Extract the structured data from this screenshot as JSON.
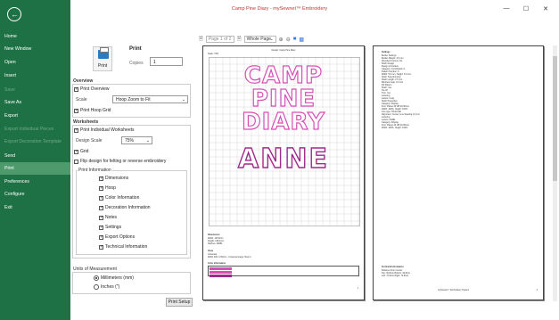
{
  "window": {
    "title": "Camp Pine Diary - mySewnet™ Embroidery",
    "minimize": "—",
    "maximize": "☐",
    "close": "✕"
  },
  "sidebar": {
    "back_icon": "arrow-left-icon",
    "items": [
      {
        "label": "Home",
        "state": "normal"
      },
      {
        "label": "New Window",
        "state": "normal"
      },
      {
        "label": "Open",
        "state": "normal"
      },
      {
        "label": "Insert",
        "state": "normal"
      },
      {
        "label": "Save",
        "state": "disabled"
      },
      {
        "label": "Save As",
        "state": "normal"
      },
      {
        "label": "Export",
        "state": "normal"
      },
      {
        "label": "Export Individual Pieces",
        "state": "disabled"
      },
      {
        "label": "Export Decoration Template",
        "state": "disabled"
      },
      {
        "label": "Send",
        "state": "normal"
      },
      {
        "label": "Print",
        "state": "active"
      },
      {
        "label": "Preferences",
        "state": "normal"
      },
      {
        "label": "Configure",
        "state": "normal"
      },
      {
        "label": "Exit",
        "state": "normal"
      }
    ]
  },
  "print": {
    "heading": "Print",
    "button_label": "Print",
    "copies_label": "Copies",
    "copies_value": "1"
  },
  "overview": {
    "title": "Overview",
    "print_overview": {
      "label": "Print Overview",
      "checked": true
    },
    "scale_label": "Scale",
    "scale_value": "Hoop Zoom to Fit",
    "print_hoop_grid": {
      "label": "Print Hoop Grid",
      "checked": true
    }
  },
  "worksheets": {
    "title": "Worksheets",
    "print_individual": {
      "label": "Print Individual Worksheets",
      "checked": true
    },
    "design_scale_label": "Design Scale",
    "design_scale_value": "75%",
    "grid": {
      "label": "Grid",
      "checked": true
    },
    "flip": {
      "label": "Flip design for felting or reverse embroidery",
      "checked": false
    },
    "print_info_title": "Print Information",
    "info_items": [
      {
        "label": "Dimensions",
        "checked": true
      },
      {
        "label": "Hoop",
        "checked": true
      },
      {
        "label": "Color Information",
        "checked": true
      },
      {
        "label": "Decoration Information",
        "checked": true
      },
      {
        "label": "Notes",
        "checked": true
      },
      {
        "label": "Settings",
        "checked": true
      },
      {
        "label": "Export Options",
        "checked": true
      },
      {
        "label": "Technical Information",
        "checked": true
      }
    ]
  },
  "units": {
    "title": "Units of Measurement",
    "options": [
      {
        "label": "Millimeters (mm)",
        "selected": true
      },
      {
        "label": "Inches (\")",
        "selected": false
      }
    ]
  },
  "print_setup_label": "Print Setup",
  "preview_toolbar": {
    "page_field": "Page 1 of 2",
    "zoom_value": "Whole Page",
    "icons": [
      "page-icon",
      "zoom-in-icon",
      "zoom-out-icon",
      "one-page-icon",
      "two-page-icon"
    ]
  },
  "page1": {
    "title": "Design: Camp Pine Diary",
    "grid_label": "Scale: 75%",
    "design_words": [
      "CAMP",
      "PINE",
      "DIARY"
    ],
    "name_word": "ANNE",
    "dimension_title": "Dimensions",
    "dimension_lines": [
      "Width: 145.9mm",
      "Height: 168.4mm",
      "Stitches: 36881"
    ],
    "hoop_title": "Hoop",
    "hoop_lines": [
      "Universal",
      "Width 240 x 150mm - Universal Large Hoop 4"
    ],
    "color_title": "Color Information",
    "page_no": "1",
    "colors": {
      "pink": "#d64fb6",
      "purple": "#a02a8c"
    }
  },
  "page2": {
    "settings_title": "Settings",
    "settings_lines": [
      "Border Settings",
      "Border Margin: 3.0 mm",
      "Rounded Corners: No",
      "Stitch Design",
      "Design of borders",
      "Category: Combination 1",
      "Pattern Number: 6",
      "Width: 5.0 mm, Height: 5.0 mm",
      "Stitch Type Running",
      "Stitch Length: 2.5 mm",
      "Minimum Gap: 0.3 mm",
      "Fill Pattern",
      "Stitch: Yes",
      "Tie-off",
      "Trim: Yes",
      "Lettering",
      "Letters: Copy",
      "Stitch Properties",
      "Category: Display",
      "Font: Planet 40 CB 20-50mm",
      "Width: 100%, Height: 100%",
      "Line type: Horizontal",
      "Alignment: Center, Line Spacing 1.0 mm",
      "Lettering",
      "Letters: ANNE",
      "Category: Display",
      "Font: Planet 40 CB 20-50mm",
      "Width: 100%, Height: 100%"
    ],
    "tech_title": "Technical Information",
    "tech_lines": [
      "Distance From Center",
      "Top: 40.8mm  Bottom: 40.8mm",
      "Left: 72.9mm  Right: 72.9mm"
    ],
    "footer": "mySewnet™ Embroidery System",
    "page_no": "2"
  }
}
